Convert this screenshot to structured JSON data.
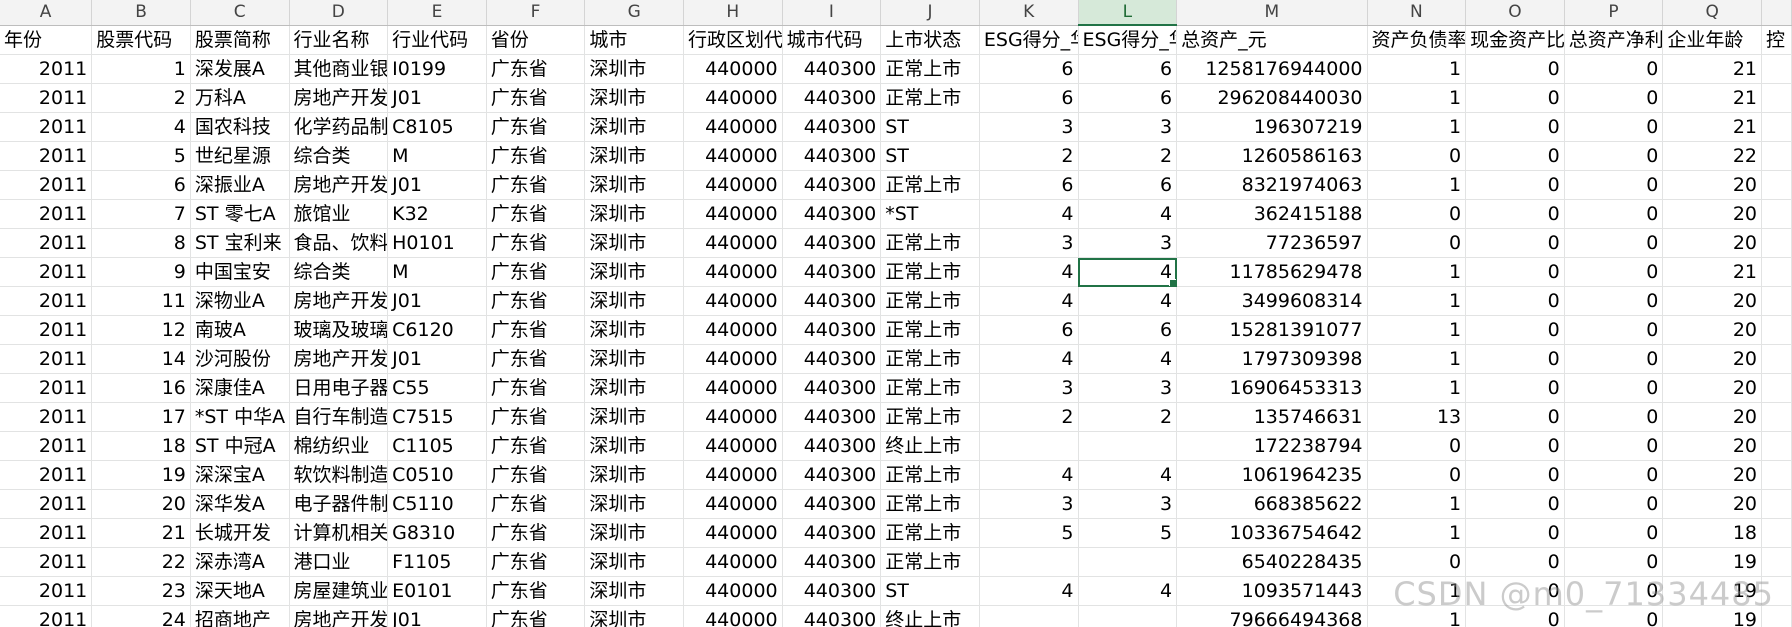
{
  "columns": [
    "A",
    "B",
    "C",
    "D",
    "E",
    "F",
    "G",
    "H",
    "I",
    "J",
    "K",
    "L",
    "M",
    "N",
    "O",
    "P",
    "Q",
    ""
  ],
  "selected_column": "L",
  "selected_cell": {
    "row": 7,
    "col": 11
  },
  "header_row": [
    "年份",
    "股票代码",
    "股票简称",
    "行业名称",
    "行业代码",
    "省份",
    "城市",
    "行政区划代码",
    "城市代码",
    "上市状态",
    "ESG得分_华证",
    "ESG得分_华证",
    "总资产_元",
    "资产负债率",
    "现金资产比",
    "总资产净利率",
    "企业年龄",
    "控"
  ],
  "rows": [
    [
      "2011",
      "1",
      "深发展A",
      "其他商业银行",
      "I0199",
      "广东省",
      "深圳市",
      "440000",
      "440300",
      "正常上市",
      "6",
      "6",
      "1258176944000",
      "1",
      "0",
      "0",
      "21",
      ""
    ],
    [
      "2011",
      "2",
      "万科A",
      "房地产开发",
      "J01",
      "广东省",
      "深圳市",
      "440000",
      "440300",
      "正常上市",
      "6",
      "6",
      "296208440030",
      "1",
      "0",
      "0",
      "21",
      ""
    ],
    [
      "2011",
      "4",
      "国农科技",
      "化学药品制造",
      "C8105",
      "广东省",
      "深圳市",
      "440000",
      "440300",
      "ST",
      "3",
      "3",
      "196307219",
      "1",
      "0",
      "0",
      "21",
      ""
    ],
    [
      "2011",
      "5",
      "世纪星源",
      "综合类",
      "M",
      "广东省",
      "深圳市",
      "440000",
      "440300",
      "ST",
      "2",
      "2",
      "1260586163",
      "0",
      "0",
      "0",
      "22",
      ""
    ],
    [
      "2011",
      "6",
      "深振业A",
      "房地产开发",
      "J01",
      "广东省",
      "深圳市",
      "440000",
      "440300",
      "正常上市",
      "6",
      "6",
      "8321974063",
      "1",
      "0",
      "0",
      "20",
      ""
    ],
    [
      "2011",
      "7",
      "ST 零七A",
      "旅馆业",
      "K32",
      "广东省",
      "深圳市",
      "440000",
      "440300",
      "*ST",
      "4",
      "4",
      "362415188",
      "0",
      "0",
      "0",
      "20",
      ""
    ],
    [
      "2011",
      "8",
      "ST 宝利来",
      "食品、饮料",
      "H0101",
      "广东省",
      "深圳市",
      "440000",
      "440300",
      "正常上市",
      "3",
      "3",
      "77236597",
      "0",
      "0",
      "0",
      "20",
      ""
    ],
    [
      "2011",
      "9",
      "中国宝安",
      "综合类",
      "M",
      "广东省",
      "深圳市",
      "440000",
      "440300",
      "正常上市",
      "4",
      "4",
      "11785629478",
      "1",
      "0",
      "0",
      "21",
      ""
    ],
    [
      "2011",
      "11",
      "深物业A",
      "房地产开发",
      "J01",
      "广东省",
      "深圳市",
      "440000",
      "440300",
      "正常上市",
      "4",
      "4",
      "3499608314",
      "1",
      "0",
      "0",
      "20",
      ""
    ],
    [
      "2011",
      "12",
      "南玻A",
      "玻璃及玻璃制品",
      "C6120",
      "广东省",
      "深圳市",
      "440000",
      "440300",
      "正常上市",
      "6",
      "6",
      "15281391077",
      "1",
      "0",
      "0",
      "20",
      ""
    ],
    [
      "2011",
      "14",
      "沙河股份",
      "房地产开发",
      "J01",
      "广东省",
      "深圳市",
      "440000",
      "440300",
      "正常上市",
      "4",
      "4",
      "1797309398",
      "1",
      "0",
      "0",
      "20",
      ""
    ],
    [
      "2011",
      "16",
      "深康佳A",
      "日用电子器具",
      "C55",
      "广东省",
      "深圳市",
      "440000",
      "440300",
      "正常上市",
      "3",
      "3",
      "16906453313",
      "1",
      "0",
      "0",
      "20",
      ""
    ],
    [
      "2011",
      "17",
      "*ST 中华A",
      "自行车制造",
      "C7515",
      "广东省",
      "深圳市",
      "440000",
      "440300",
      "正常上市",
      "2",
      "2",
      "135746631",
      "13",
      "0",
      "0",
      "20",
      ""
    ],
    [
      "2011",
      "18",
      "ST 中冠A",
      "棉纺织业",
      "C1105",
      "广东省",
      "深圳市",
      "440000",
      "440300",
      "终止上市",
      "",
      "",
      "172238794",
      "0",
      "0",
      "0",
      "20",
      ""
    ],
    [
      "2011",
      "19",
      "深深宝A",
      "软饮料制造",
      "C0510",
      "广东省",
      "深圳市",
      "440000",
      "440300",
      "正常上市",
      "4",
      "4",
      "1061964235",
      "0",
      "0",
      "0",
      "20",
      ""
    ],
    [
      "2011",
      "20",
      "深华发A",
      "电子器件制造",
      "C5110",
      "广东省",
      "深圳市",
      "440000",
      "440300",
      "正常上市",
      "3",
      "3",
      "668385622",
      "1",
      "0",
      "0",
      "20",
      ""
    ],
    [
      "2011",
      "21",
      "长城开发",
      "计算机相关设备",
      "G8310",
      "广东省",
      "深圳市",
      "440000",
      "440300",
      "正常上市",
      "5",
      "5",
      "10336754642",
      "1",
      "0",
      "0",
      "18",
      ""
    ],
    [
      "2011",
      "22",
      "深赤湾A",
      "港口业",
      "F1105",
      "广东省",
      "深圳市",
      "440000",
      "440300",
      "正常上市",
      "",
      "",
      "6540228435",
      "0",
      "0",
      "0",
      "19",
      ""
    ],
    [
      "2011",
      "23",
      "深天地A",
      "房屋建筑业",
      "E0101",
      "广东省",
      "深圳市",
      "440000",
      "440300",
      "ST",
      "4",
      "4",
      "1093571443",
      "1",
      "0",
      "0",
      "19",
      ""
    ],
    [
      "2011",
      "24",
      "招商地产",
      "房地产开发",
      "J01",
      "广东省",
      "深圳市",
      "440000",
      "440300",
      "终止上市",
      "",
      "",
      "79666494368",
      "1",
      "0",
      "0",
      "19",
      ""
    ]
  ],
  "watermark": "CSDN @m0_71334485"
}
